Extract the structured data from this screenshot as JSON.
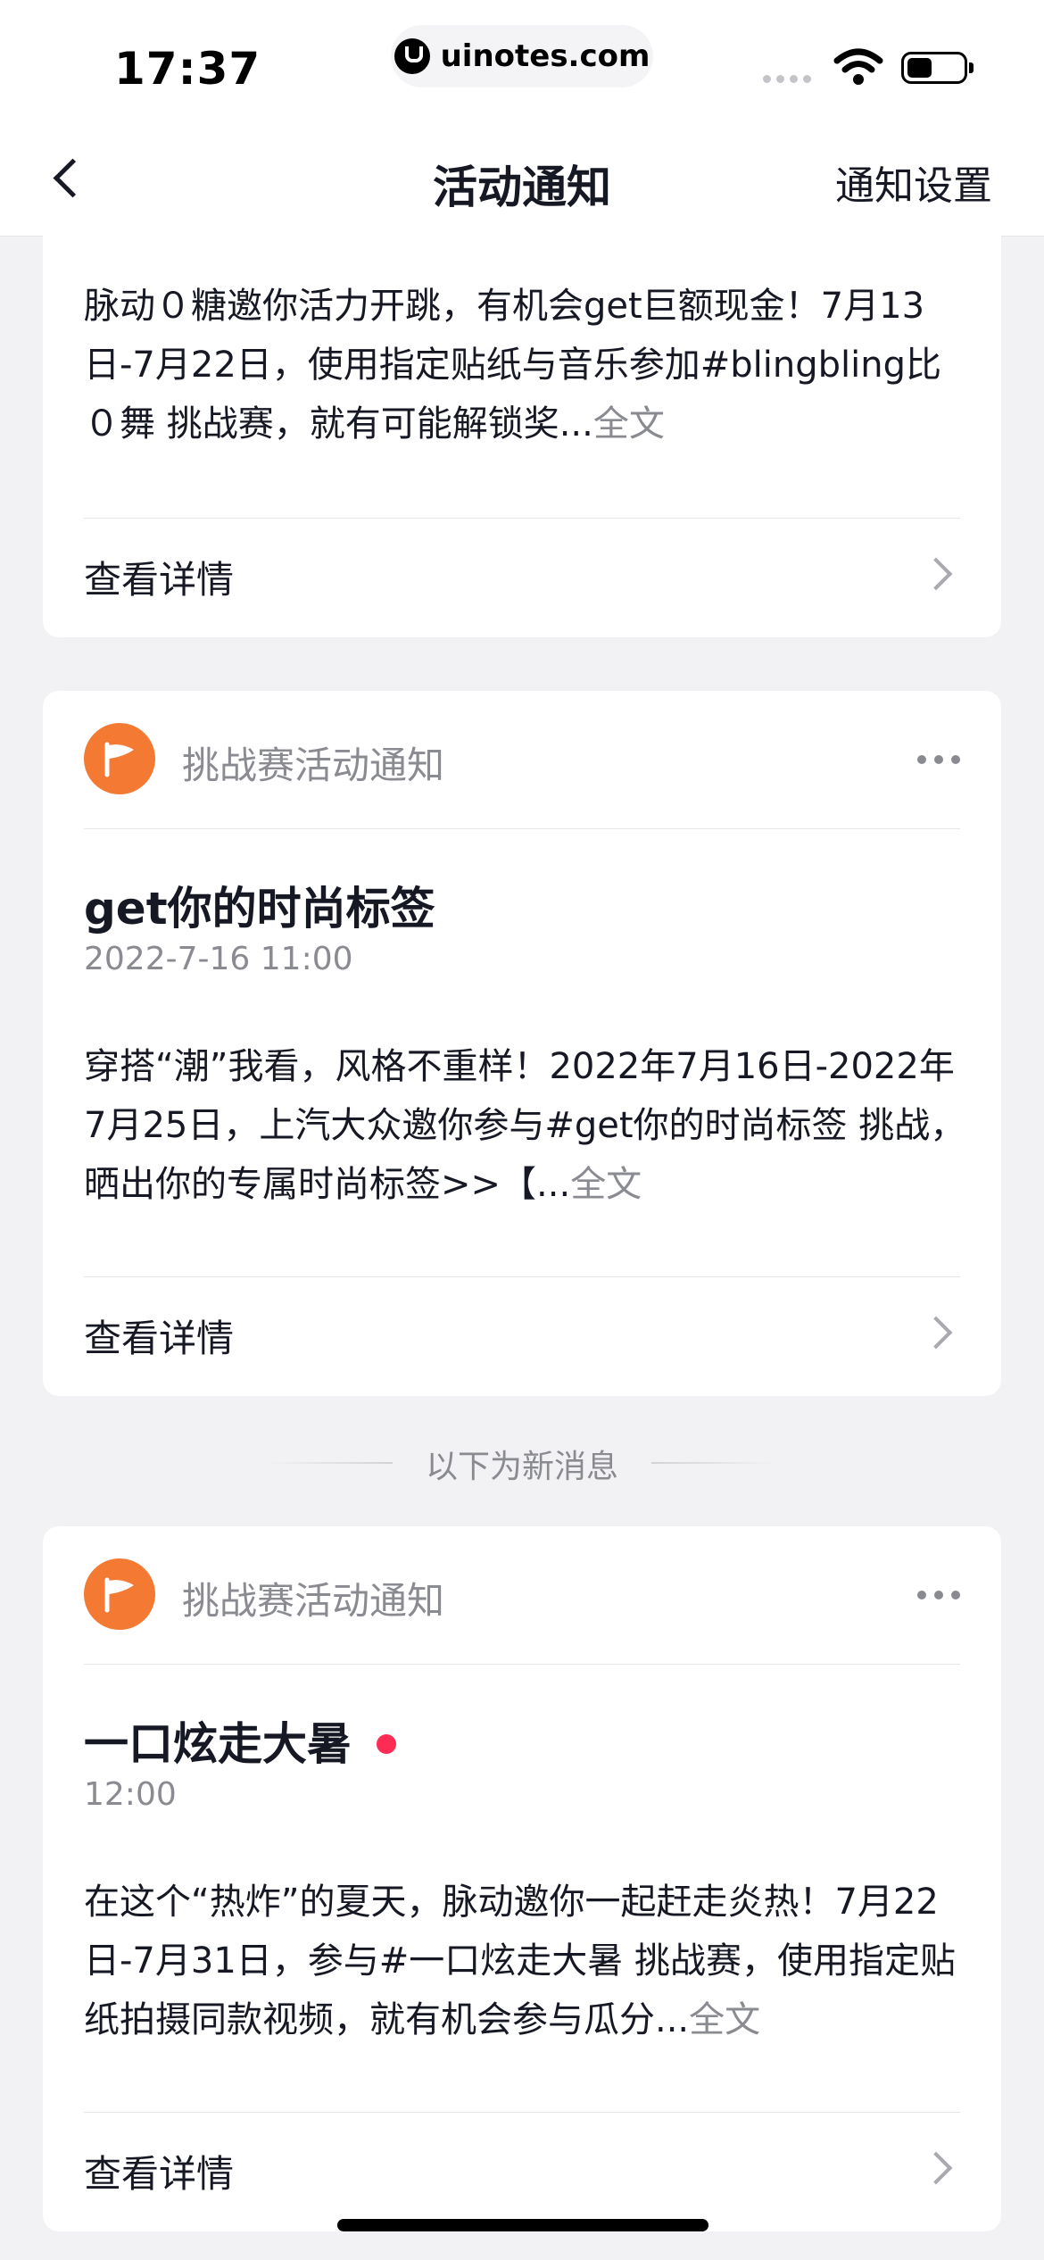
{
  "status_bar": {
    "time": "17:37",
    "url": "uinotes.com"
  },
  "nav": {
    "title": "活动通知",
    "settings_label": "通知设置"
  },
  "cards": [
    {
      "body": "脉动０糖邀你活力开跳，有机会get巨额现金！7月13日-7月22日，使用指定贴纸与音乐参加#blingbling比０舞 挑战赛，就有可能解锁奖...",
      "full_text_label": "全文",
      "detail_label": "查看详情"
    },
    {
      "sender": "挑战赛活动通知",
      "title": "get你的时尚标签",
      "date": "2022-7-16 11:00",
      "body": "穿搭“潮”我看，风格不重样！2022年7月16日-2022年7月25日，上汽大众邀你参与#get你的时尚标签 挑战，晒出你的专属时尚标签>>【...",
      "full_text_label": "全文",
      "detail_label": "查看详情"
    },
    {
      "sender": "挑战赛活动通知",
      "title": "一口炫走大暑",
      "date": "12:00",
      "body": "在这个“热炸”的夏天，脉动邀你一起赶走炎热！7月22日-7月31日，参与#一口炫走大暑 挑战赛，使用指定贴纸拍摄同款视频，就有机会参与瓜分...",
      "full_text_label": "全文",
      "detail_label": "查看详情",
      "unread": true
    }
  ],
  "new_messages_label": "以下为新消息",
  "icons": {
    "back": "chevron-left-icon",
    "avatar": "flag-icon",
    "more": "more-dots-icon",
    "detail": "chevron-right-icon",
    "wifi": "wifi-icon",
    "battery": "battery-icon"
  },
  "colors": {
    "avatar_bg": "#f47a33",
    "unread_dot": "#fe2c55",
    "secondary_text": "#8a8b91"
  },
  "battery_level": 0.45
}
